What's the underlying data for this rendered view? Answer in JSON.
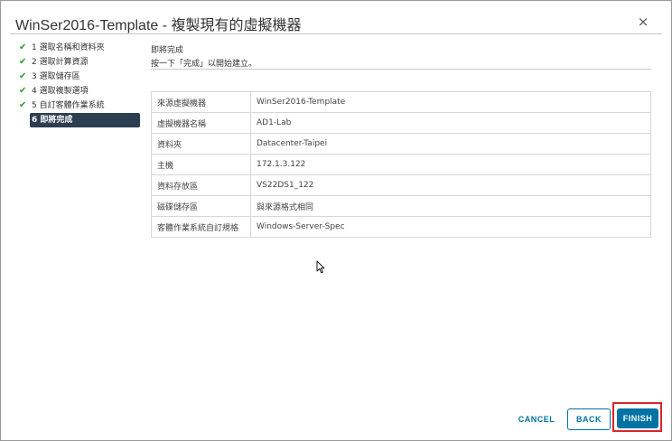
{
  "dialog": {
    "title": "WinSer2016-Template - 複製現有的虛擬機器",
    "close_icon": "×"
  },
  "wizard": {
    "steps": [
      {
        "label": "1 選取名稱和資料夾",
        "done": true
      },
      {
        "label": "2 選取計算資源",
        "done": true
      },
      {
        "label": "3 選取儲存區",
        "done": true
      },
      {
        "label": "4 選取複製選項",
        "done": true
      },
      {
        "label": "5 自訂客體作業系統",
        "done": true
      },
      {
        "label": "6 即將完成",
        "done": false,
        "active": true
      }
    ],
    "check_glyph": "✔"
  },
  "main": {
    "section_title": "即將完成",
    "section_desc": "按一下「完成」以開始建立。",
    "rows": [
      {
        "key": "來源虛擬機器",
        "value": "WinSer2016-Template"
      },
      {
        "key": "虛擬機器名稱",
        "value": "AD1-Lab"
      },
      {
        "key": "資料夾",
        "value": "Datacenter-Taipei"
      },
      {
        "key": "主機",
        "value": "172.1.3.122"
      },
      {
        "key": "資料存放區",
        "value": "VS22DS1_122"
      },
      {
        "key": "磁碟儲存區",
        "value": "與來源格式相同"
      },
      {
        "key": "客體作業系統自訂規格",
        "value": "Windows-Server-Spec"
      }
    ]
  },
  "footer": {
    "cancel_label": "CANCEL",
    "back_label": "BACK",
    "finish_label": "FINISH"
  },
  "colors": {
    "accent": "#0072a3",
    "active_step_bg": "#2c3e50",
    "check": "#2f9a2f",
    "highlight": "#d9262a"
  }
}
